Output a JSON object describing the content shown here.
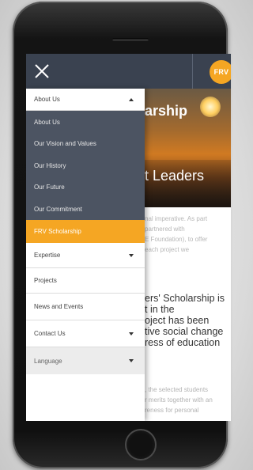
{
  "header": {
    "logo_text": "FRV"
  },
  "page": {
    "hero_title_line1": "arship",
    "hero_title_line2": "t Leaders",
    "intro_lines": [
      "nal imperative. As part",
      "partnered with",
      "E Foundation), to offer",
      "each project we"
    ],
    "section_heading_lines": [
      "ers' Scholarship is",
      "t in the",
      "oject has been",
      "tive social change",
      "ress of education"
    ],
    "body_lines": [
      ", the selected students",
      "r merits together with an",
      "reness for personal"
    ]
  },
  "menu": {
    "about": "About Us",
    "about_sub": [
      "About Us",
      "Our Vision and Values",
      "Our History",
      "Our Future",
      "Our Commitment"
    ],
    "active": "FRV Scholarship",
    "expertise": "Expertise",
    "projects": "Projects",
    "news": "News and Events",
    "contact": "Contact Us",
    "language": "Language"
  },
  "colors": {
    "accent": "#f5a623",
    "menu_dark": "#4c5462",
    "topbar": "#3a4250"
  }
}
